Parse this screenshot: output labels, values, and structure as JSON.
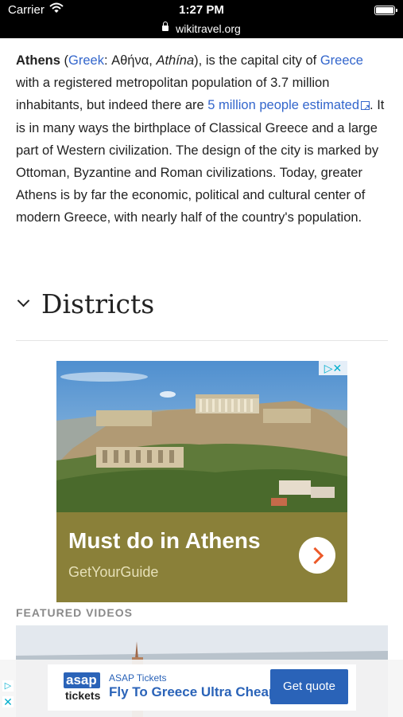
{
  "status_bar": {
    "carrier": "Carrier",
    "time": "1:27 PM"
  },
  "browser": {
    "url": "wikitravel.org"
  },
  "article": {
    "title_word": "Athens",
    "open_paren": " (",
    "greek_link": "Greek",
    "greek_text": ": Αθήνα, ",
    "athina": "Athína",
    "after_athina": "), is the capital city of ",
    "greece_link": "Greece",
    "population_text": " with a registered metropolitan population of 3.7 million inhabitants, but indeed there are ",
    "estimate_link": "5 million people estimated",
    "rest": ". It is in many ways the birthplace of Classical Greece and a large part of Western civilization. The design of the city is marked by Ottoman, Byzantine and Roman civilizations. Today, greater Athens is by far the economic, political and cultural center of modern Greece, with nearly half of the country's population."
  },
  "section": {
    "districts_title": "Districts"
  },
  "ad": {
    "title": "Must do in Athens",
    "source": "GetYourGuide",
    "badge": "▷✕"
  },
  "featured": {
    "label": "FEATURED VIDEOS"
  },
  "banner": {
    "logo_top": "asap",
    "logo_bottom": "tickets",
    "advertiser": "ASAP Tickets",
    "headline": "Fly To Greece Ultra Cheap",
    "cta": "Get quote",
    "info": "▷",
    "close": "✕"
  },
  "colors": {
    "link": "#3366cc",
    "ad_panel": "#8a8039",
    "banner_blue": "#2a63b8",
    "adchoices": "#00aecd"
  }
}
